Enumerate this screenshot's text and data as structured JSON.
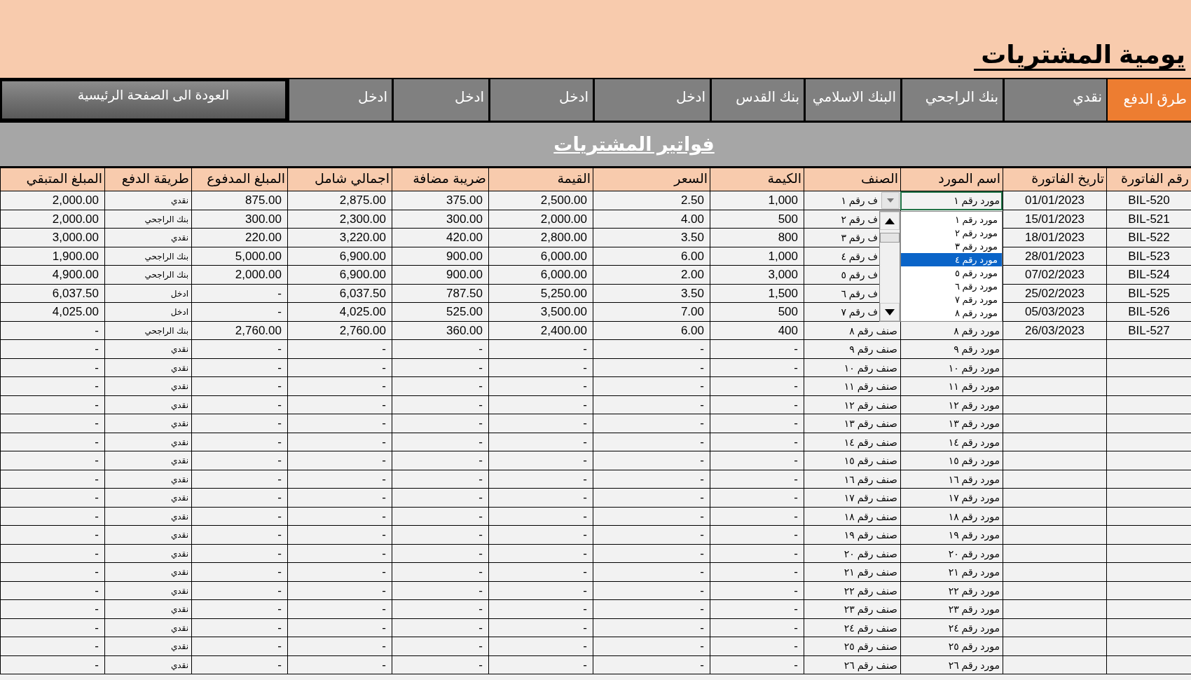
{
  "title": "يومية المشتريات",
  "payment_bar": {
    "label": "طرق الدفع",
    "methods": [
      "نقدي",
      "بنك الراجحي",
      "البنك الاسلامي",
      "بنك القدس",
      "ادخل",
      "ادخل",
      "ادخل",
      "ادخل"
    ],
    "back_button": "العودة الى الصفحة الرئيسية"
  },
  "section_title": "فواتير المشتريات",
  "table": {
    "columns": [
      "رقم الفاتورة",
      "تاريخ الفاتورة",
      "اسم المورد",
      "الصنف",
      "الكيمة",
      "السعر",
      "القيمة",
      "ضريبة مضافة",
      "اجمالي شامل",
      "المبلغ المدفوع",
      "طريقة الدفع",
      "المبلغ المتبقي"
    ],
    "rows": [
      {
        "selected": true,
        "cells": [
          "BIL-520",
          "01/01/2023",
          "مورد رقم ١",
          "ف رقم ١",
          "1,000",
          "2.50",
          "2,500.00",
          "375.00",
          "2,875.00",
          "875.00",
          "نقدي",
          "2,000.00"
        ]
      },
      {
        "selected": false,
        "cells": [
          "BIL-521",
          "15/01/2023",
          null,
          "ف رقم ٢",
          "500",
          "4.00",
          "2,000.00",
          "300.00",
          "2,300.00",
          "300.00",
          "بنك الراجحي",
          "2,000.00"
        ]
      },
      {
        "selected": false,
        "cells": [
          "BIL-522",
          "18/01/2023",
          null,
          "ف رقم ٣",
          "800",
          "3.50",
          "2,800.00",
          "420.00",
          "3,220.00",
          "220.00",
          "نقدي",
          "3,000.00"
        ]
      },
      {
        "selected": false,
        "cells": [
          "BIL-523",
          "28/01/2023",
          null,
          "ف رقم ٤",
          "1,000",
          "6.00",
          "6,000.00",
          "900.00",
          "6,900.00",
          "5,000.00",
          "بنك الراجحي",
          "1,900.00"
        ]
      },
      {
        "selected": false,
        "cells": [
          "BIL-524",
          "07/02/2023",
          null,
          "ف رقم ٥",
          "3,000",
          "2.00",
          "6,000.00",
          "900.00",
          "6,900.00",
          "2,000.00",
          "بنك الراجحي",
          "4,900.00"
        ]
      },
      {
        "selected": false,
        "cells": [
          "BIL-525",
          "25/02/2023",
          null,
          "ف رقم ٦",
          "1,500",
          "3.50",
          "5,250.00",
          "787.50",
          "6,037.50",
          "-",
          "ادخل",
          "6,037.50"
        ]
      },
      {
        "selected": false,
        "cells": [
          "BIL-526",
          "05/03/2023",
          null,
          "ف رقم ٧",
          "500",
          "7.00",
          "3,500.00",
          "525.00",
          "4,025.00",
          "-",
          "ادخل",
          "4,025.00"
        ]
      },
      {
        "selected": false,
        "cells": [
          "BIL-527",
          "26/03/2023",
          "مورد رقم ٨",
          "صنف رقم ٨",
          "400",
          "6.00",
          "2,400.00",
          "360.00",
          "2,760.00",
          "2,760.00",
          "بنك الراجحي",
          "-"
        ]
      },
      {
        "selected": false,
        "cells": [
          null,
          null,
          "مورد رقم ٩",
          "صنف رقم ٩",
          "-",
          "-",
          "-",
          "-",
          "-",
          "-",
          "نقدي",
          "-"
        ]
      },
      {
        "selected": false,
        "cells": [
          null,
          null,
          "مورد رقم ١٠",
          "صنف رقم ١٠",
          "-",
          "-",
          "-",
          "-",
          "-",
          "-",
          "نقدي",
          "-"
        ]
      },
      {
        "selected": false,
        "cells": [
          null,
          null,
          "مورد رقم ١١",
          "صنف رقم ١١",
          "-",
          "-",
          "-",
          "-",
          "-",
          "-",
          "نقدي",
          "-"
        ]
      },
      {
        "selected": false,
        "cells": [
          null,
          null,
          "مورد رقم ١٢",
          "صنف رقم ١٢",
          "-",
          "-",
          "-",
          "-",
          "-",
          "-",
          "نقدي",
          "-"
        ]
      },
      {
        "selected": false,
        "cells": [
          null,
          null,
          "مورد رقم ١٣",
          "صنف رقم ١٣",
          "-",
          "-",
          "-",
          "-",
          "-",
          "-",
          "نقدي",
          "-"
        ]
      },
      {
        "selected": false,
        "cells": [
          null,
          null,
          "مورد رقم ١٤",
          "صنف رقم ١٤",
          "-",
          "-",
          "-",
          "-",
          "-",
          "-",
          "نقدي",
          "-"
        ]
      },
      {
        "selected": false,
        "cells": [
          null,
          null,
          "مورد رقم ١٥",
          "صنف رقم ١٥",
          "-",
          "-",
          "-",
          "-",
          "-",
          "-",
          "نقدي",
          "-"
        ]
      },
      {
        "selected": false,
        "cells": [
          null,
          null,
          "مورد رقم ١٦",
          "صنف رقم ١٦",
          "-",
          "-",
          "-",
          "-",
          "-",
          "-",
          "نقدي",
          "-"
        ]
      },
      {
        "selected": false,
        "cells": [
          null,
          null,
          "مورد رقم ١٧",
          "صنف رقم ١٧",
          "-",
          "-",
          "-",
          "-",
          "-",
          "-",
          "نقدي",
          "-"
        ]
      },
      {
        "selected": false,
        "cells": [
          null,
          null,
          "مورد رقم ١٨",
          "صنف رقم ١٨",
          "-",
          "-",
          "-",
          "-",
          "-",
          "-",
          "نقدي",
          "-"
        ]
      },
      {
        "selected": false,
        "cells": [
          null,
          null,
          "مورد رقم ١٩",
          "صنف رقم ١٩",
          "-",
          "-",
          "-",
          "-",
          "-",
          "-",
          "نقدي",
          "-"
        ]
      },
      {
        "selected": false,
        "cells": [
          null,
          null,
          "مورد رقم ٢٠",
          "صنف رقم ٢٠",
          "-",
          "-",
          "-",
          "-",
          "-",
          "-",
          "نقدي",
          "-"
        ]
      },
      {
        "selected": false,
        "cells": [
          null,
          null,
          "مورد رقم ٢١",
          "صنف رقم ٢١",
          "-",
          "-",
          "-",
          "-",
          "-",
          "-",
          "نقدي",
          "-"
        ]
      },
      {
        "selected": false,
        "cells": [
          null,
          null,
          "مورد رقم ٢٢",
          "صنف رقم ٢٢",
          "-",
          "-",
          "-",
          "-",
          "-",
          "-",
          "نقدي",
          "-"
        ]
      },
      {
        "selected": false,
        "cells": [
          null,
          null,
          "مورد رقم ٢٣",
          "صنف رقم ٢٣",
          "-",
          "-",
          "-",
          "-",
          "-",
          "-",
          "نقدي",
          "-"
        ]
      },
      {
        "selected": false,
        "cells": [
          null,
          null,
          "مورد رقم ٢٤",
          "صنف رقم ٢٤",
          "-",
          "-",
          "-",
          "-",
          "-",
          "-",
          "نقدي",
          "-"
        ]
      },
      {
        "selected": false,
        "cells": [
          null,
          null,
          "مورد رقم ٢٥",
          "صنف رقم ٢٥",
          "-",
          "-",
          "-",
          "-",
          "-",
          "-",
          "نقدي",
          "-"
        ]
      },
      {
        "selected": false,
        "cells": [
          null,
          null,
          "مورد رقم ٢٦",
          "صنف رقم ٢٦",
          "-",
          "-",
          "-",
          "-",
          "-",
          "-",
          "نقدي",
          "-"
        ]
      }
    ],
    "dropdown": {
      "items": [
        {
          "label": "مورد رقم ١",
          "selected": false
        },
        {
          "label": "مورد رقم ٢",
          "selected": false
        },
        {
          "label": "مورد رقم ٣",
          "selected": false
        },
        {
          "label": "مورد رقم ٤",
          "selected": true
        },
        {
          "label": "مورد رقم ٥",
          "selected": false
        },
        {
          "label": "مورد رقم ٦",
          "selected": false
        },
        {
          "label": "مورد رقم ٧",
          "selected": false
        },
        {
          "label": "مورد رقم ٨",
          "selected": false
        }
      ]
    }
  }
}
